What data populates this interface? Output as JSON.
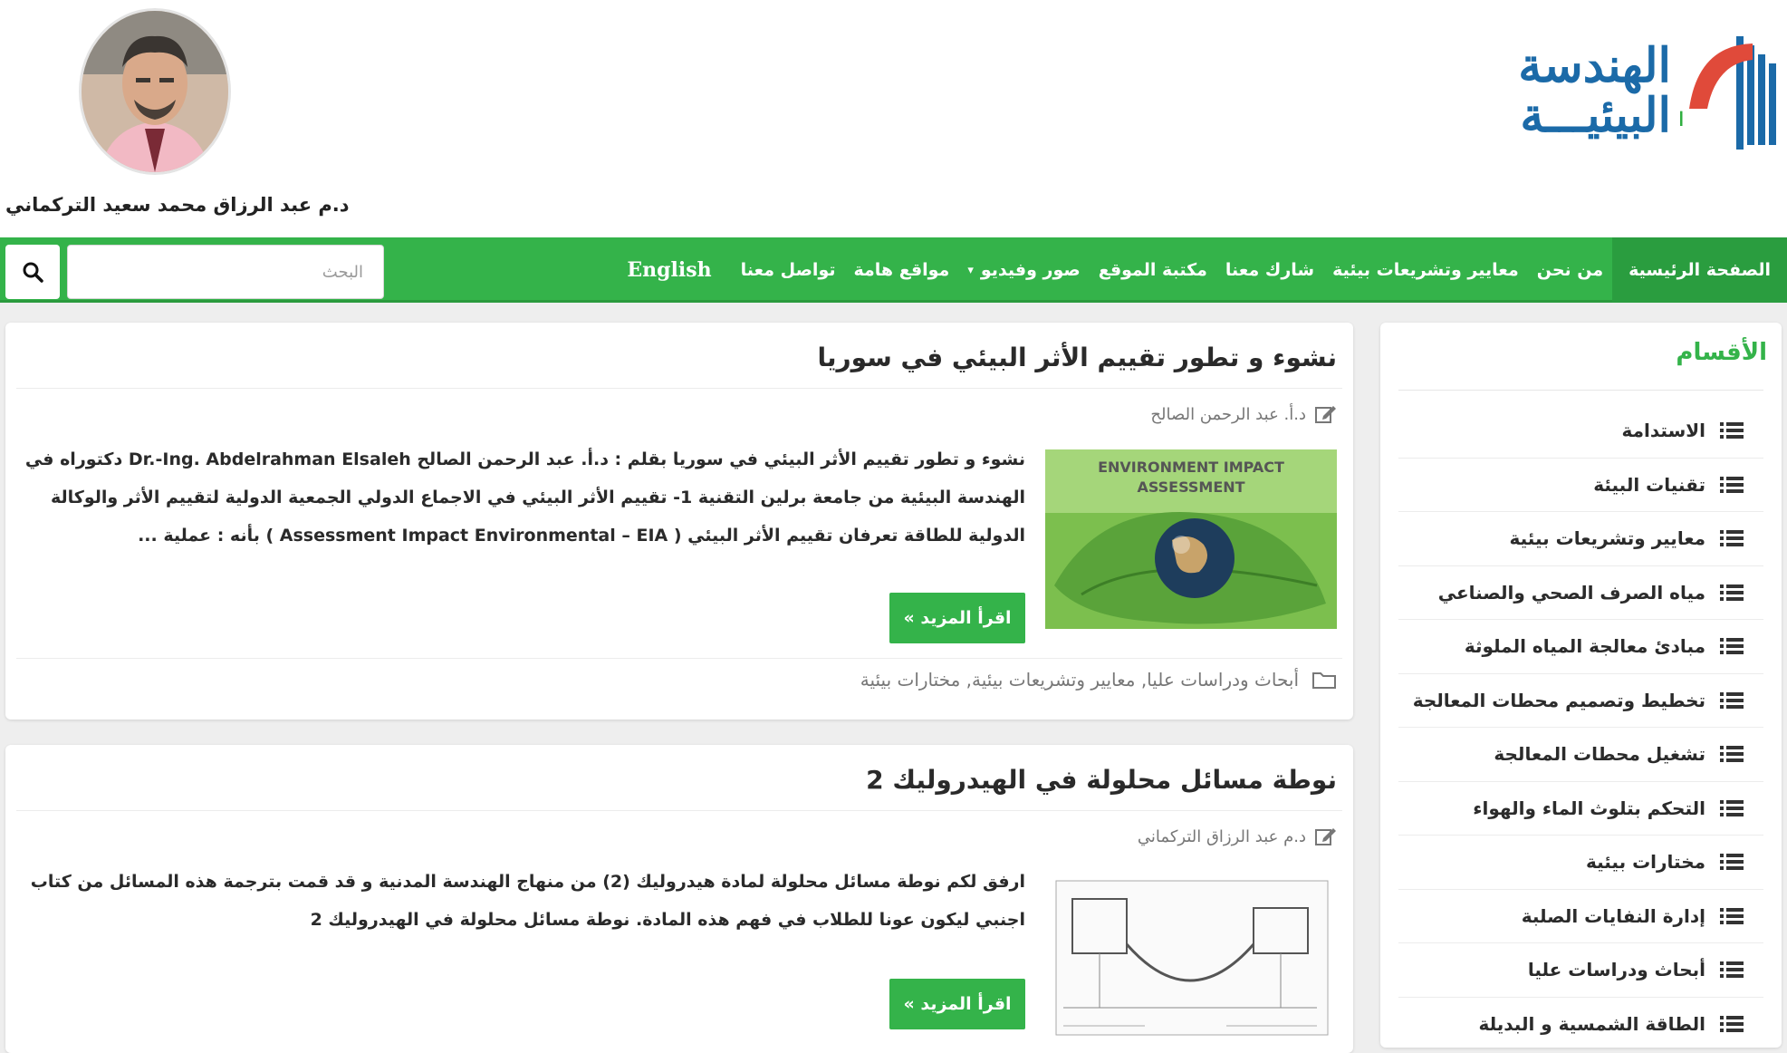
{
  "header": {
    "logo_line1": "الهندسة",
    "logo_line2": "البيئيـــة",
    "logo_mark_text": "4",
    "profile_name": "د.م عبد الرزاق محمد سعيد التركماني"
  },
  "nav": {
    "items": [
      {
        "label": "الصفحة الرئيسية",
        "active": true
      },
      {
        "label": "من نحن"
      },
      {
        "label": "معايير وتشريعات بيئية"
      },
      {
        "label": "شارك معنا"
      },
      {
        "label": "مكتبة الموقع"
      },
      {
        "label": "صور وفيديو",
        "has_caret": true,
        "caret": "▾"
      },
      {
        "label": "مواقع هامة"
      },
      {
        "label": "تواصل معنا"
      },
      {
        "label": "English"
      }
    ],
    "search_placeholder": "البحث",
    "search_icon": "search-icon"
  },
  "sidebar": {
    "title": "الأقسام",
    "icon": "list-icon",
    "categories": [
      "الاستدامة",
      "تقنيات البيئة",
      "معايير وتشريعات بيئية",
      "مياه الصرف الصحي والصناعي",
      "مبادئ معالجة المياه الملوثة",
      "تخطيط وتصميم محطات المعالجة",
      "تشغيل محطات المعالجة",
      "التحكم بتلوث الماء والهواء",
      "مختارات بيئية",
      "إدارة النفايات الصلبة",
      "أبحاث ودراسات عليا",
      "الطاقة الشمسية و البديلة"
    ]
  },
  "posts": [
    {
      "title": "نشوء و تطور تقييم الأثر البيئي في سوريا",
      "author": "د.أ. عبد الرحمن الصالح",
      "thumb_caption_line1": "ENVIRONMENT IMPACT",
      "thumb_caption_line2": "ASSESSMENT",
      "excerpt": "نشوء و تطور تقييم الأثر البيئي في سوريا بقلم : د.أ. عبد الرحمن الصالح Dr.-Ing. Abdelrahman Elsaleh دكتوراه في الهندسة البيئية من جامعة برلين التقنية   1- تقييم الأثر البيئي في الاجماع الدولي الجمعية الدولية لتقييم الأثر والوكالة الدولية للطاقة تعرفان تقييم الأثر البيئي ( Assessment Impact Environmental – EIA ) بأنه : عملية ...",
      "more_label": "اقرأ المزيد »",
      "tags": "أبحاث ودراسات عليا, معايير وتشريعات بيئية, مختارات بيئية"
    },
    {
      "title": "نوطة مسائل محلولة في الهيدروليك 2",
      "author": "د.م عبد الرزاق التركماني",
      "excerpt": "ارفق لكم نوطة مسائل محلولة لمادة هيدروليك (2) من منهاج الهندسة المدنية و قد قمت بترجمة هذه المسائل من كتاب اجنبي ليكون عونا للطلاب في فهم هذه المادة. نوطة مسائل محلولة في الهيدروليك 2",
      "more_label": "اقرأ المزيد »"
    }
  ],
  "colors": {
    "brand_green": "#34b34a",
    "logo_blue": "#1b6aa8",
    "logo_green": "#2fae3f"
  }
}
